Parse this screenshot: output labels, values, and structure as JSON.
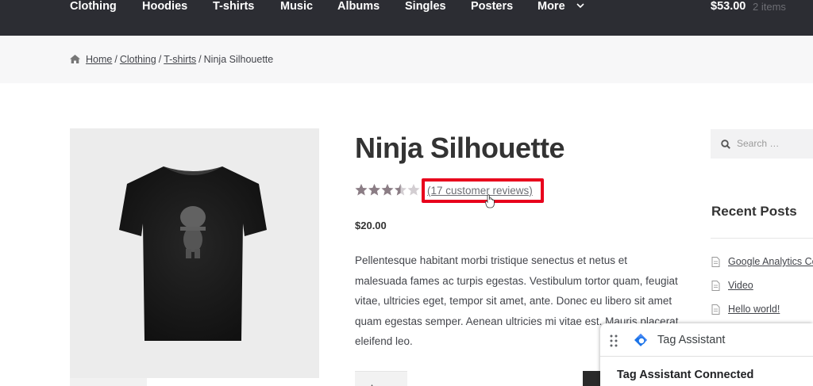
{
  "nav": {
    "items": [
      "Clothing",
      "Hoodies",
      "T-shirts",
      "Music",
      "Albums",
      "Singles",
      "Posters",
      "More"
    ],
    "cart_total": "$53.00",
    "cart_count": "2 items"
  },
  "breadcrumb": {
    "items": [
      "Home",
      "Clothing",
      "T-shirts"
    ],
    "current": "Ninja Silhouette",
    "separator": "/"
  },
  "product": {
    "title": "Ninja Silhouette",
    "rating": 3.5,
    "rating_max": 5,
    "reviews_link": "(17 customer reviews)",
    "price": "$20.00",
    "description": "Pellentesque habitant morbi tristique senectus et netus et malesuada fames ac turpis egestas. Vestibulum tortor quam, feugiat vitae, ultricies eget, tempor sit amet, ante. Donec eu libero sit amet quam egestas semper. Aenean ultricies mi vitae est. Mauris placerat eleifend leo."
  },
  "sidebar": {
    "search_placeholder": "Search …",
    "recent_posts_title": "Recent Posts",
    "recent_posts": [
      "Google Analytics Co",
      "Video",
      "Hello world!"
    ]
  },
  "tag_assistant": {
    "title": "Tag Assistant",
    "status": "Tag Assistant Connected"
  },
  "colors": {
    "nav_bg": "#2c2d33",
    "highlight_border": "#e8001c",
    "star_filled": "#8b7d85"
  }
}
